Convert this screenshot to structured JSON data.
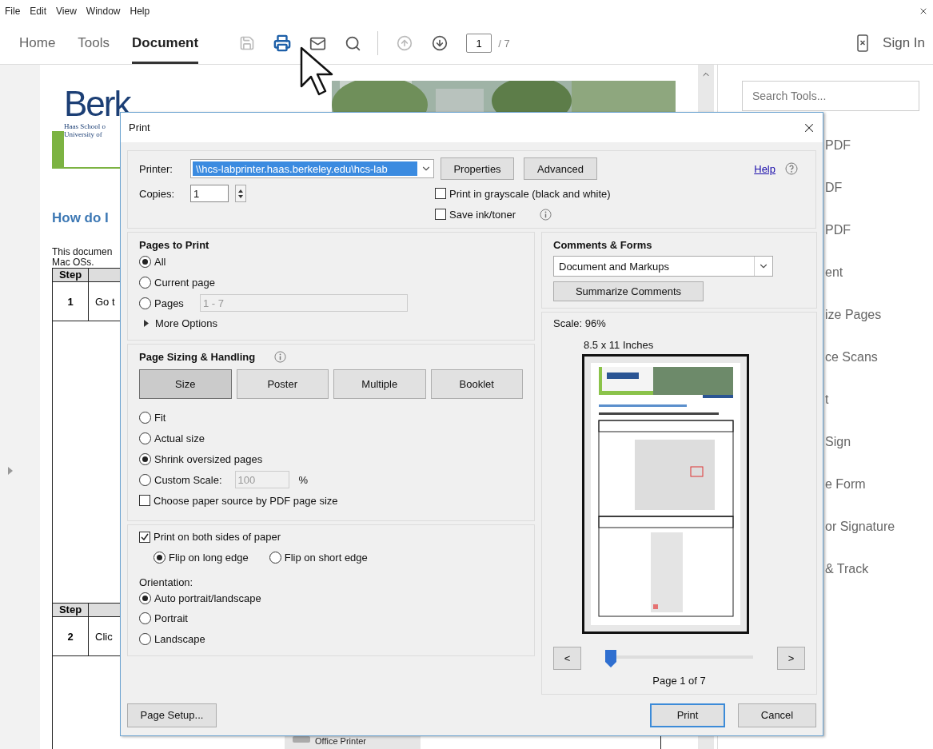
{
  "menu_bar": {
    "items": [
      "File",
      "Edit",
      "View",
      "Window",
      "Help"
    ]
  },
  "toolbar": {
    "tabs": [
      {
        "label": "Home",
        "selected": false
      },
      {
        "label": "Tools",
        "selected": false
      },
      {
        "label": "Document",
        "selected": true
      }
    ],
    "page": "1",
    "total": "/ 7",
    "sign_in": "Sign In"
  },
  "document": {
    "logo": "Berk",
    "logo_lines": [
      "Haas School o",
      "University of"
    ],
    "heading": "How do I",
    "intro": [
      "This documen",
      "Mac OSs."
    ],
    "tables": [
      {
        "header": "Step",
        "step": "1",
        "text": "Go t"
      },
      {
        "header": "Step",
        "step": "2",
        "text": "Clic",
        "caption": "Office Printer"
      }
    ]
  },
  "tools_panel": {
    "search": {
      "placeholder": "Search Tools..."
    },
    "items": [
      "PDF",
      "DF",
      "PDF",
      "ent",
      "ize Pages",
      "ce Scans",
      "t",
      "Sign",
      "e Form",
      "or Signature",
      "& Track"
    ]
  },
  "print_dialog": {
    "title": "Print",
    "printer": {
      "label": "Printer:",
      "value": "\\\\hcs-labprinter.haas.berkeley.edu\\hcs-lab"
    },
    "properties": "Properties",
    "advanced": "Advanced",
    "help": "Help",
    "copies": {
      "label": "Copies:",
      "value": "1"
    },
    "grayscale": {
      "label": "Print in grayscale (black and white)",
      "checked": false
    },
    "save_ink": {
      "label": "Save ink/toner",
      "checked": false
    },
    "pages": {
      "title": "Pages to Print",
      "options": [
        {
          "label": "All",
          "selected": true
        },
        {
          "label": "Current page",
          "selected": false
        },
        {
          "label": "Pages",
          "selected": false
        }
      ],
      "range": "1 - 7",
      "more": "More Options"
    },
    "sizing": {
      "title": "Page Sizing & Handling",
      "modes": [
        {
          "label": "Size",
          "selected": true
        },
        {
          "label": "Poster",
          "selected": false
        },
        {
          "label": "Multiple",
          "selected": false
        },
        {
          "label": "Booklet",
          "selected": false
        }
      ],
      "options": [
        {
          "label": "Fit",
          "selected": false
        },
        {
          "label": "Actual size",
          "selected": false
        },
        {
          "label": "Shrink oversized pages",
          "selected": true
        },
        {
          "label": "Custom Scale:",
          "selected": false
        }
      ],
      "scale": "100",
      "percent": "%",
      "paper_source": {
        "label": "Choose paper source by PDF page size",
        "checked": false
      }
    },
    "duplex": {
      "both_sides": {
        "label": "Print on both sides of paper",
        "checked": true
      },
      "flip": [
        {
          "label": "Flip on long edge",
          "selected": true
        },
        {
          "label": "Flip on short edge",
          "selected": false
        }
      ],
      "orientation_label": "Orientation:",
      "orientation": [
        {
          "label": "Auto portrait/landscape",
          "selected": true
        },
        {
          "label": "Portrait",
          "selected": false
        },
        {
          "label": "Landscape",
          "selected": false
        }
      ]
    },
    "comments": {
      "title": "Comments & Forms",
      "mode": "Document and Markups",
      "summarize": "Summarize Comments"
    },
    "preview": {
      "scale": "Scale:  96%",
      "size": "8.5 x 11 Inches",
      "prev": "<",
      "next": ">",
      "level": 0,
      "page": "Page 1 of 7"
    },
    "page_setup": "Page Setup...",
    "print": "Print",
    "cancel": "Cancel"
  }
}
